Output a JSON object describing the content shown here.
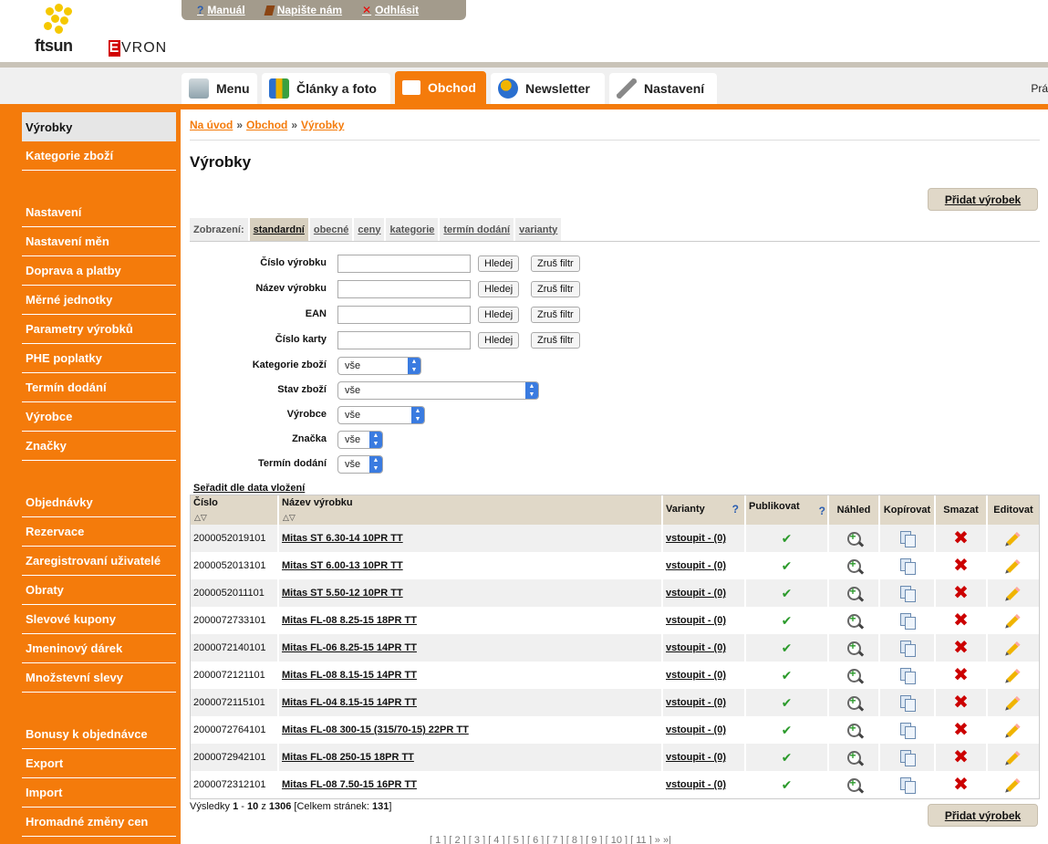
{
  "header": {
    "brand_ftsun": "ftsun",
    "brand_evron": "EVRON",
    "links": [
      {
        "label": "Manuál"
      },
      {
        "label": "Napište nám"
      },
      {
        "label": "Odhlásit"
      }
    ]
  },
  "tabs": [
    {
      "label": "Menu"
    },
    {
      "label": "Články a foto"
    },
    {
      "label": "Obchod"
    },
    {
      "label": "Newsletter"
    },
    {
      "label": "Nastavení"
    }
  ],
  "tab_trail": "Prá",
  "sidebar": [
    {
      "label": "Výrobky"
    },
    {
      "label": "Kategorie zboží"
    },
    {
      "label": "Nastavení"
    },
    {
      "label": "Nastavení měn"
    },
    {
      "label": "Doprava a platby"
    },
    {
      "label": "Měrné jednotky"
    },
    {
      "label": "Parametry výrobků"
    },
    {
      "label": "PHE poplatky"
    },
    {
      "label": "Termín dodání"
    },
    {
      "label": "Výrobce"
    },
    {
      "label": "Značky"
    },
    {
      "label": "Objednávky"
    },
    {
      "label": "Rezervace"
    },
    {
      "label": "Zaregistrovaní uživatelé"
    },
    {
      "label": "Obraty"
    },
    {
      "label": "Slevové kupony"
    },
    {
      "label": "Jmeninový dárek"
    },
    {
      "label": "Množstevní slevy"
    },
    {
      "label": "Bonusy k objednávce"
    },
    {
      "label": "Export"
    },
    {
      "label": "Import"
    },
    {
      "label": "Hromadné změny cen"
    }
  ],
  "breadcrumb": [
    "Na úvod",
    "Obchod",
    "Výrobky"
  ],
  "page_title": "Výrobky",
  "add_button": "Přidat výrobek",
  "view": {
    "label": "Zobrazení:",
    "options": [
      "standardní",
      "obecné",
      "ceny",
      "kategorie",
      "termín dodání",
      "varianty"
    ]
  },
  "filters": {
    "text": [
      {
        "label": "Číslo výrobku"
      },
      {
        "label": "Název výrobku"
      },
      {
        "label": "EAN"
      },
      {
        "label": "Číslo karty"
      }
    ],
    "search_btn": "Hledej",
    "clear_btn": "Zruš filtr",
    "selects": [
      {
        "label": "Kategorie zboží",
        "value": "vše"
      },
      {
        "label": "Stav zboží",
        "value": "vše"
      },
      {
        "label": "Výrobce",
        "value": "vše"
      },
      {
        "label": "Značka",
        "value": "vše"
      },
      {
        "label": "Termín dodání",
        "value": "vše"
      }
    ]
  },
  "sort_label": "Seřadit dle data vložení",
  "table": {
    "headers": [
      "Číslo",
      "Název výrobku",
      "Varianty",
      "Publikovat",
      "Náhled",
      "Kopírovat",
      "Smazat",
      "Editovat"
    ],
    "variant_link": "vstoupit - (0)",
    "rows": [
      {
        "number": "2000052019101",
        "name": "Mitas ST 6.30-14 10PR TT"
      },
      {
        "number": "2000052013101",
        "name": "Mitas ST 6.00-13 10PR TT"
      },
      {
        "number": "2000052011101",
        "name": "Mitas ST 5.50-12 10PR TT"
      },
      {
        "number": "2000072733101",
        "name": "Mitas FL-08 8.25-15 18PR TT"
      },
      {
        "number": "2000072140101",
        "name": "Mitas FL-06 8.25-15 14PR TT"
      },
      {
        "number": "2000072121101",
        "name": "Mitas FL-08 8.15-15 14PR TT"
      },
      {
        "number": "2000072115101",
        "name": "Mitas FL-04 8.15-15 14PR TT"
      },
      {
        "number": "2000072764101",
        "name": "Mitas FL-08 300-15 (315/70-15) 22PR TT"
      },
      {
        "number": "2000072942101",
        "name": "Mitas FL-08 250-15 18PR TT"
      },
      {
        "number": "2000072312101",
        "name": "Mitas FL-08 7.50-15 16PR TT"
      }
    ]
  },
  "results": {
    "prefix": "Výsledky",
    "from": "1",
    "to": "10",
    "of_word": "z",
    "total": "1306",
    "pages_label": "[Celkem stránek:",
    "pages": "131",
    "pages_close": "]"
  },
  "pager": "[ 1 ] [ 2 ] [ 3 ] [ 4 ] [ 5 ] [ 6 ] [ 7 ] [ 8 ] [ 9 ] [ 10 ] [ 11 ] » »|",
  "colors": {
    "accent": "#f47b0b",
    "header_bg": "#e0d8c8",
    "link_bar": "#a39b8c"
  }
}
